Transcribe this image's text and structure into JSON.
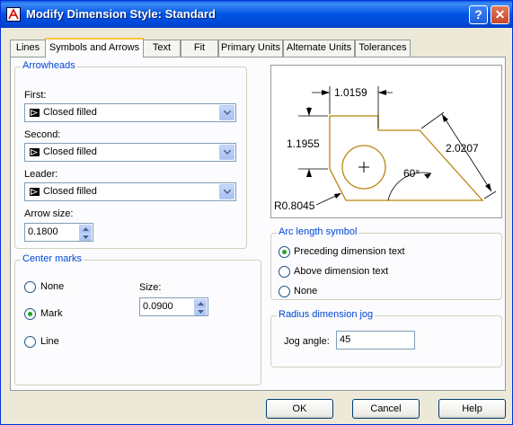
{
  "window": {
    "title": "Modify Dimension Style: Standard",
    "help_label": "?",
    "close_label": "✕"
  },
  "tabs": [
    {
      "label": "Lines"
    },
    {
      "label": "Symbols and Arrows",
      "active": true
    },
    {
      "label": "Text"
    },
    {
      "label": "Fit"
    },
    {
      "label": "Primary Units"
    },
    {
      "label": "Alternate Units"
    },
    {
      "label": "Tolerances"
    }
  ],
  "arrowheads": {
    "title": "Arrowheads",
    "first_label": "First:",
    "first_value": "Closed filled",
    "second_label": "Second:",
    "second_value": "Closed filled",
    "leader_label": "Leader:",
    "leader_value": "Closed filled",
    "size_label": "Arrow size:",
    "size_value": "0.1800"
  },
  "center_marks": {
    "title": "Center marks",
    "options": [
      "None",
      "Mark",
      "Line"
    ],
    "selected": "Mark",
    "size_label": "Size:",
    "size_value": "0.0900"
  },
  "preview": {
    "dim_top": "1.0159",
    "dim_left": "1.1955",
    "dim_diag": "2.0207",
    "angle": "60°",
    "radius": "R0.8045"
  },
  "arc_length": {
    "title": "Arc length symbol",
    "options": [
      "Preceding dimension text",
      "Above dimension text",
      "None"
    ],
    "selected": "Preceding dimension text"
  },
  "radius_jog": {
    "title": "Radius dimension jog",
    "angle_label": "Jog angle:",
    "angle_value": "45"
  },
  "buttons": {
    "ok": "OK",
    "cancel": "Cancel",
    "help": "Help"
  },
  "colors": {
    "title_bar": "#0054e3",
    "group_title": "#0046d5",
    "preview_shape": "#b8860b"
  }
}
